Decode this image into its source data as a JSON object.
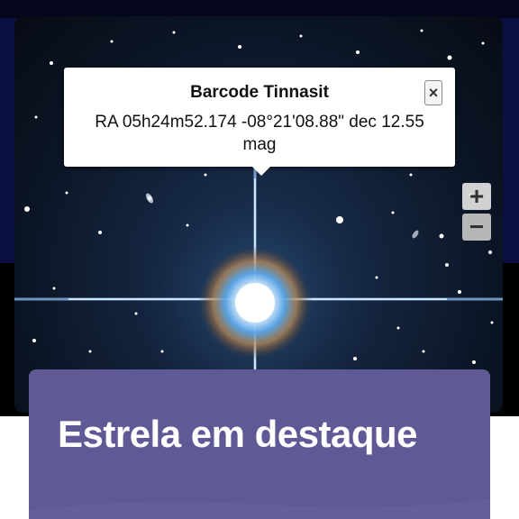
{
  "popup": {
    "title": "Barcode Tinnasit",
    "body": "RA 05h24m52.174 -08°21'08.88\" dec 12.55 mag",
    "close_label": "×"
  },
  "map_controls": {
    "zoom_in_label": "+",
    "zoom_out_label": "−"
  },
  "card": {
    "title": "Estrela em destaque"
  },
  "colors": {
    "card_background": "#5f5a96",
    "page_navy": "#0b1040",
    "sky_dark": "#0b1424"
  },
  "icons": [
    "close-icon",
    "zoom-in-icon",
    "zoom-out-icon"
  ]
}
